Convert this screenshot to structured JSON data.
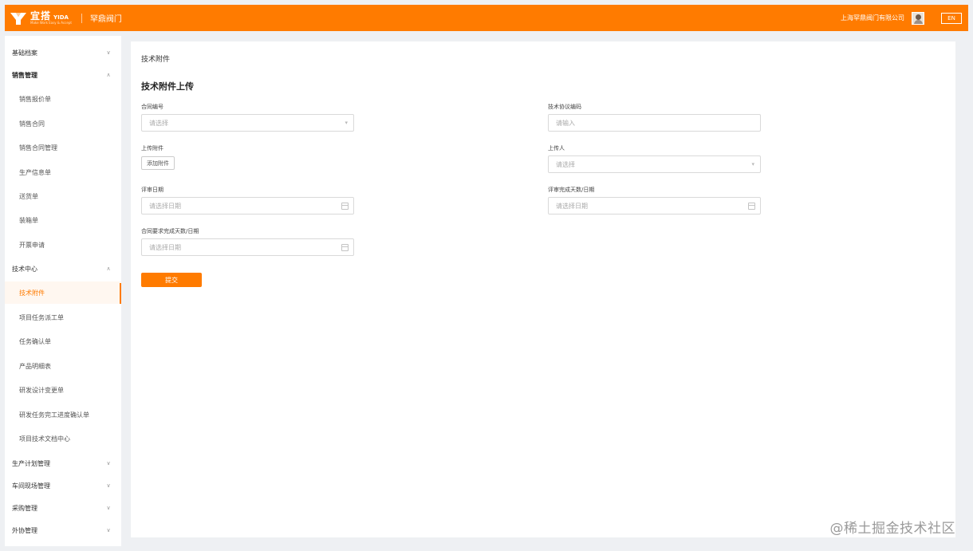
{
  "header": {
    "logo_zh": "宜搭",
    "logo_en": "YIDA",
    "logo_tagline": "Make Work Easy & Accept",
    "brand_title": "罕鼎阀门",
    "company": "上海罕鼎阀门有限公司",
    "lang_button": "EN",
    "accent_color": "#ff7b00"
  },
  "sidebar": {
    "items": [
      {
        "label": "基础档案",
        "type": "group",
        "expanded": false,
        "chevron": "chevron-down-icon"
      },
      {
        "label": "销售管理",
        "type": "group",
        "expanded": true,
        "chevron": "chevron-up-icon"
      },
      {
        "label": "销售报价单",
        "type": "sub"
      },
      {
        "label": "销售合同",
        "type": "sub"
      },
      {
        "label": "销售合同管理",
        "type": "sub"
      },
      {
        "label": "生产信息单",
        "type": "sub"
      },
      {
        "label": "送货单",
        "type": "sub"
      },
      {
        "label": "装箱单",
        "type": "sub"
      },
      {
        "label": "开票申请",
        "type": "sub"
      },
      {
        "label": "技术中心",
        "type": "group",
        "expanded": true,
        "chevron": "chevron-up-icon"
      },
      {
        "label": "技术附件",
        "type": "sub",
        "active": true
      },
      {
        "label": "项目任务派工单",
        "type": "sub"
      },
      {
        "label": "任务确认单",
        "type": "sub"
      },
      {
        "label": "产品明细表",
        "type": "sub"
      },
      {
        "label": "研发设计变更单",
        "type": "sub"
      },
      {
        "label": "研发任务完工进度确认单",
        "type": "sub"
      },
      {
        "label": "项目技术文档中心",
        "type": "sub"
      },
      {
        "label": "生产计划管理",
        "type": "group",
        "expanded": false,
        "chevron": "chevron-down-icon"
      },
      {
        "label": "车间现场管理",
        "type": "group",
        "expanded": false,
        "chevron": "chevron-down-icon"
      },
      {
        "label": "采购管理",
        "type": "group",
        "expanded": false,
        "chevron": "chevron-down-icon"
      },
      {
        "label": "外协管理",
        "type": "group",
        "expanded": false,
        "chevron": "chevron-down-icon"
      }
    ]
  },
  "main": {
    "breadcrumb": "技术附件",
    "form_title": "技术附件上传",
    "fields": {
      "contract_no": {
        "label": "合同编号",
        "placeholder": "请选择"
      },
      "tech_agreement_code": {
        "label": "技术协议编码",
        "placeholder": "请输入"
      },
      "upload_attachment": {
        "label": "上传附件",
        "button": "添加附件"
      },
      "uploader": {
        "label": "上传人",
        "placeholder": "请选择"
      },
      "review_date": {
        "label": "评审日期",
        "placeholder": "请选择日期"
      },
      "review_done_date": {
        "label": "评审完成天数/日期",
        "placeholder": "请选择日期"
      },
      "required_done_date": {
        "label": "合同要求完成天数/日期",
        "placeholder": "请选择日期"
      }
    },
    "submit_label": "提交"
  },
  "watermark": "@稀土掘金技术社区"
}
